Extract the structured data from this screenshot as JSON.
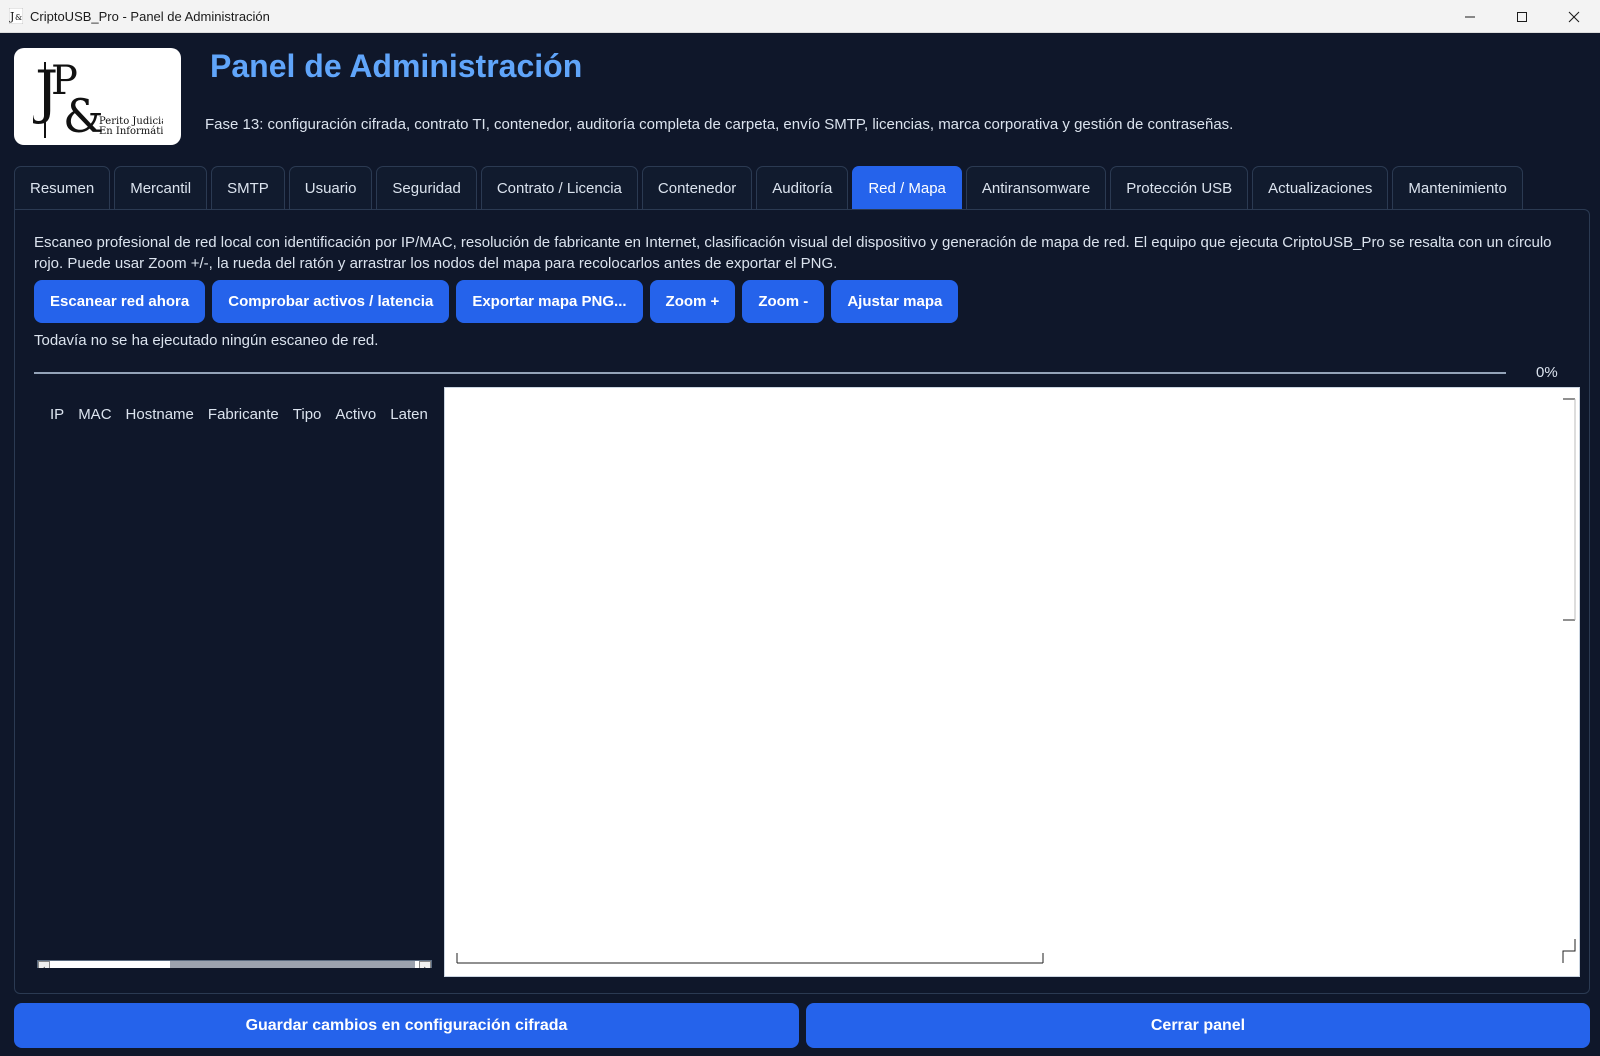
{
  "window": {
    "title": "CriptoUSB_Pro - Panel de Administración",
    "controls": {
      "minimize": "—",
      "maximize": "☐",
      "close": "✕"
    }
  },
  "header": {
    "title": "Panel de Administración",
    "subtitle": "Fase 13: configuración cifrada, contrato TI, contenedor, auditoría completa de carpeta, envío SMTP, licencias, marca corporativa y gestión de contraseñas.",
    "logo": {
      "mark": "JP&",
      "line1": "Perito Judicial",
      "line2": "En Informática"
    }
  },
  "tabs": [
    {
      "label": "Resumen",
      "active": false
    },
    {
      "label": "Mercantil",
      "active": false
    },
    {
      "label": "SMTP",
      "active": false
    },
    {
      "label": "Usuario",
      "active": false
    },
    {
      "label": "Seguridad",
      "active": false
    },
    {
      "label": "Contrato / Licencia",
      "active": false
    },
    {
      "label": "Contenedor",
      "active": false
    },
    {
      "label": "Auditoría",
      "active": false
    },
    {
      "label": "Red / Mapa",
      "active": true
    },
    {
      "label": "Antiransomware",
      "active": false
    },
    {
      "label": "Protección USB",
      "active": false
    },
    {
      "label": "Actualizaciones",
      "active": false
    },
    {
      "label": "Mantenimiento",
      "active": false
    }
  ],
  "network": {
    "description": "Escaneo profesional de red local con identificación por IP/MAC, resolución de fabricante en Internet, clasificación visual del dispositivo y generación de mapa de red. El equipo que ejecuta CriptoUSB_Pro se resalta con un círculo rojo. Puede usar Zoom +/-, la rueda del ratón y arrastrar los nodos del mapa para recolocarlos antes de exportar el PNG.",
    "buttons": {
      "scan": "Escanear red ahora",
      "check": "Comprobar activos / latencia",
      "export": "Exportar mapa PNG...",
      "zoom_in": "Zoom +",
      "zoom_out": "Zoom -",
      "fit": "Ajustar mapa"
    },
    "status": "Todavía no se ha ejecutado ningún escaneo de red.",
    "progress": {
      "value": 0,
      "label": "0%"
    },
    "table": {
      "columns": [
        "IP",
        "MAC",
        "Hostname",
        "Fabricante",
        "Tipo",
        "Activo",
        "Laten"
      ],
      "rows": []
    }
  },
  "footer": {
    "save": "Guardar cambios en configuración cifrada",
    "close": "Cerrar panel"
  },
  "colors": {
    "background": "#0f172a",
    "accent": "#2563eb",
    "title": "#60a5fa"
  }
}
